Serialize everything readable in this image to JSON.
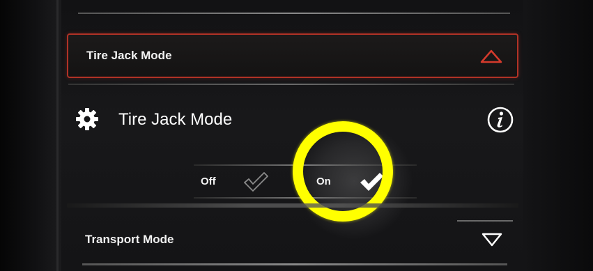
{
  "menu": {
    "active_row_label": "Tire Jack Mode",
    "next_row_label": "Transport Mode"
  },
  "setting": {
    "title": "Tire Jack Mode",
    "options": [
      {
        "label": "Off",
        "selected": false
      },
      {
        "label": "On",
        "selected": true
      }
    ]
  },
  "icons": {
    "setting": "gear-icon",
    "info": "info-icon",
    "collapse": "chevron-up-icon",
    "expand": "chevron-down-icon",
    "check": "checkmark-icon"
  },
  "colors": {
    "active_border": "#b13226",
    "collapse_chevron": "#d43a2c",
    "highlight_ring": "#ffff00",
    "background": "#141416"
  }
}
